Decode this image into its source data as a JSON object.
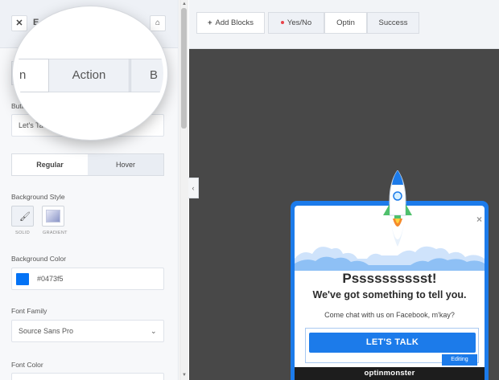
{
  "editor_panel": {
    "header": {
      "close_icon": "close-icon",
      "title": "E",
      "home_icon": "home-icon"
    },
    "tabs": [
      {
        "label": "",
        "active": true
      },
      {
        "label": "Action",
        "active": false
      },
      {
        "label": "",
        "active": false
      }
    ],
    "button_text": {
      "label": "Butt",
      "value": "Let's Ta"
    },
    "state_tabs": {
      "regular": "Regular",
      "hover": "Hover",
      "active": "regular"
    },
    "background_style": {
      "label": "Background Style",
      "options": [
        "SOLID",
        "GRADIENT"
      ],
      "icons": [
        "paint-brush-icon",
        "gradient-icon"
      ]
    },
    "background_color": {
      "label": "Background Color",
      "value": "#0473f5"
    },
    "font_family": {
      "label": "Font Family",
      "value": "Source Sans Pro"
    },
    "font_color": {
      "label": "Font Color"
    }
  },
  "magnifier": {
    "tab_partial_left": "n",
    "tab_center": "Action",
    "tab_partial_right": "B"
  },
  "toolbar": {
    "add_blocks": "Add Blocks",
    "add_icon": "plus-icon",
    "yes_no": "Yes/No",
    "yes_no_dot_color": "#e8434b",
    "optin": "Optin",
    "success": "Success",
    "active_view": "Optin"
  },
  "canvas": {
    "collapse_icon": "chevron-left-icon",
    "background": "#484848"
  },
  "popup": {
    "accent_color": "#1c7bea",
    "close": "×",
    "headline": "Psssssssssst!",
    "subheadline": "We've got something to tell you.",
    "text": "Come chat with us on Facebook, m'kay?",
    "button_label": "LET'S TALK",
    "editing_badge": "Editing",
    "brand": "optinmonster"
  }
}
